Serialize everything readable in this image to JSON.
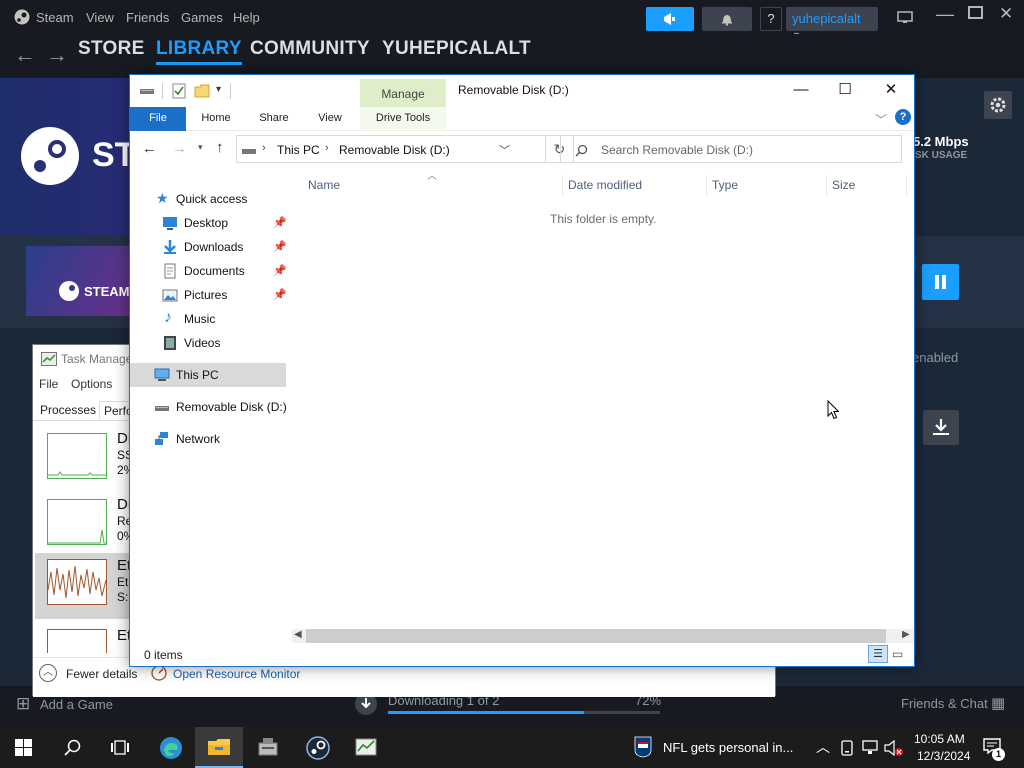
{
  "steam": {
    "titlebar": {
      "app_name": "Steam",
      "menus": [
        "View",
        "Friends",
        "Games",
        "Help"
      ],
      "help_q": "?",
      "username": "yuhepicalalt"
    },
    "nav": {
      "back": "←",
      "forward": "→",
      "links": [
        "STORE",
        "LIBRARY",
        "COMMUNITY",
        "YUHEPICALALT"
      ]
    },
    "hero": {
      "logo_text": "ST",
      "speed": "5.2 Mbps",
      "disk_usage": "SK USAGE"
    },
    "band": {
      "thumb_text": "STEAM"
    },
    "mid": {
      "enabled_text": "enabled"
    },
    "bottombar": {
      "add_game": "Add a Game",
      "downloading": "Downloading 1 of 2",
      "percent": "72%",
      "friends_chat": "Friends & Chat"
    }
  },
  "taskmgr": {
    "title": "Task Manage",
    "menus": [
      "File",
      "Options"
    ],
    "tabs": [
      "Processes",
      "Perfo"
    ],
    "items": [
      {
        "line1": "Di",
        "line2": "SS",
        "line3": "2%"
      },
      {
        "line1": "Di",
        "line2": "Re",
        "line3": "0%"
      },
      {
        "line1": "Et",
        "line2": "Et",
        "line3": "S:"
      },
      {
        "line1": "Et",
        "line2": "",
        "line3": ""
      }
    ],
    "footer": {
      "fewer_details": "Fewer details",
      "open_resource_monitor": "Open Resource Monitor"
    }
  },
  "explorer": {
    "title": "Removable Disk (D:)",
    "manage_tab": "Manage",
    "ribbon_tabs": [
      "File",
      "Home",
      "Share",
      "View",
      "Drive Tools"
    ],
    "window_controls": {
      "minimize": "—",
      "maximize": "☐",
      "close": "✕"
    },
    "address": {
      "crumbs": [
        "This PC",
        "Removable Disk (D:)"
      ]
    },
    "search": {
      "placeholder": "Search Removable Disk (D:)"
    },
    "nav": {
      "quick_access": "Quick access",
      "quick_items": [
        {
          "label": "Desktop",
          "icon": "desktop-icon",
          "pinned": true
        },
        {
          "label": "Downloads",
          "icon": "downloads-icon",
          "pinned": true
        },
        {
          "label": "Documents",
          "icon": "documents-icon",
          "pinned": true
        },
        {
          "label": "Pictures",
          "icon": "pictures-icon",
          "pinned": true
        },
        {
          "label": "Music",
          "icon": "music-icon",
          "pinned": false
        },
        {
          "label": "Videos",
          "icon": "videos-icon",
          "pinned": false
        }
      ],
      "this_pc": "This PC",
      "removable": "Removable Disk (D:)",
      "network": "Network"
    },
    "columns": [
      "Name",
      "Date modified",
      "Type",
      "Size"
    ],
    "empty_message": "This folder is empty.",
    "status": "0 items"
  },
  "taskbar": {
    "news": "NFL gets personal in...",
    "time": "10:05 AM",
    "date": "12/3/2024",
    "notification_count": "1"
  },
  "colors": {
    "steam_bg": "#1b2838",
    "steam_accent": "#1a9fff",
    "explorer_accent": "#1a6fc9",
    "manage_green": "#dfeec9",
    "taskbar_bg": "#1c1c1c"
  }
}
